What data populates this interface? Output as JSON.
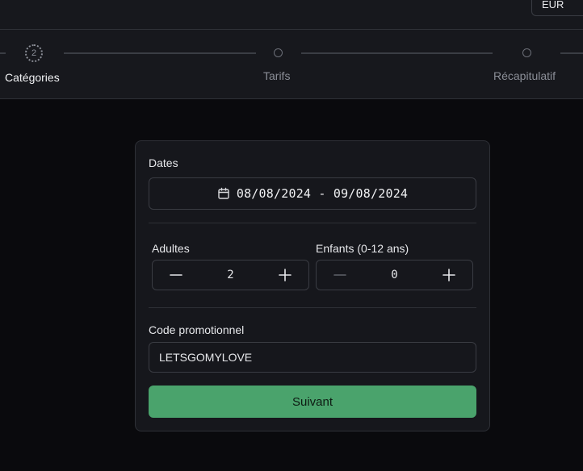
{
  "header": {
    "currency": "EUR"
  },
  "steps": [
    {
      "number": "2",
      "label": "Catégories",
      "state": "active"
    },
    {
      "label": "Tarifs",
      "state": "upcoming"
    },
    {
      "label": "Récapitulatif",
      "state": "upcoming"
    }
  ],
  "form": {
    "dates_label": "Dates",
    "dates_value": "08/08/2024 - 09/08/2024",
    "adults_label": "Adultes",
    "adults_value": "2",
    "children_label": "Enfants (0-12 ans)",
    "children_value": "0",
    "promo_label": "Code promotionnel",
    "promo_value": "LETSGOMYLOVE",
    "next_label": "Suivant"
  },
  "colors": {
    "accent": "#4aa36c",
    "background": "#0a0a0d",
    "panel": "#17181d",
    "border": "#2e3036"
  }
}
